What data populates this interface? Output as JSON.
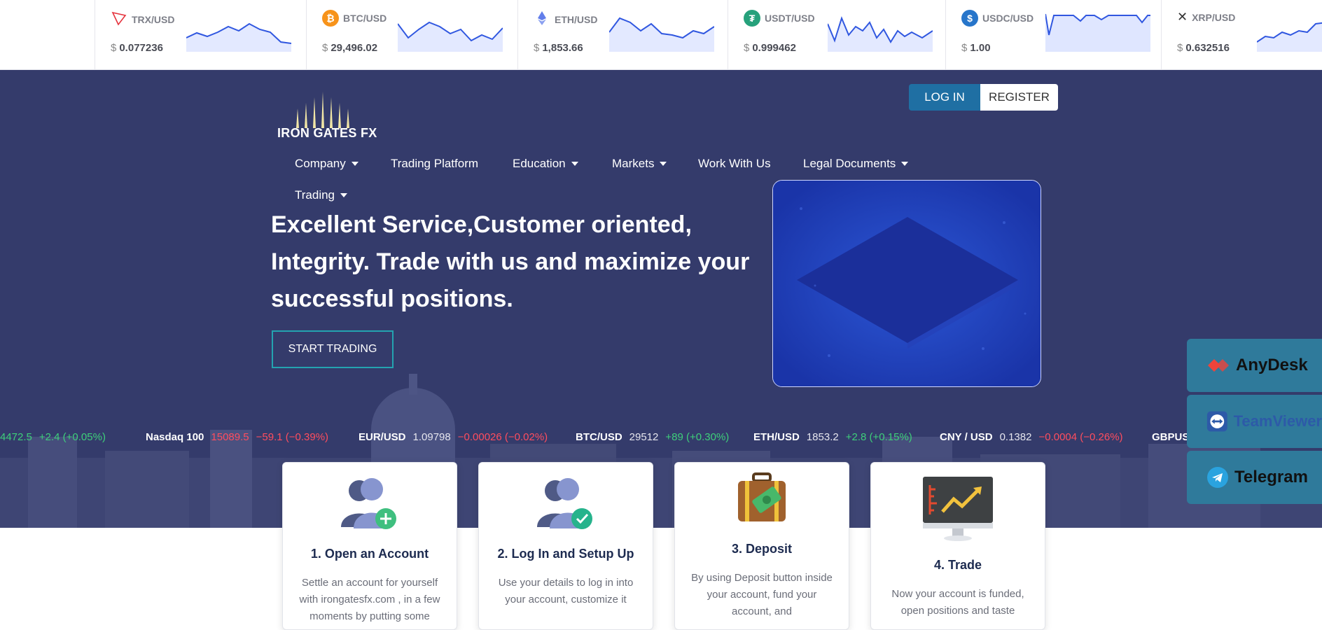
{
  "crypto_ticker": [
    {
      "pair": "TRX/USD",
      "currency": "$",
      "price": "0.077236",
      "icon": "tron-icon",
      "color": "#e5323c"
    },
    {
      "pair": "BTC/USD",
      "currency": "$",
      "price": "29,496.02",
      "icon": "bitcoin-icon",
      "color": "#f7931a"
    },
    {
      "pair": "ETH/USD",
      "currency": "$",
      "price": "1,853.66",
      "icon": "ethereum-icon",
      "color": "#627eea"
    },
    {
      "pair": "USDT/USD",
      "currency": "$",
      "price": "0.999462",
      "icon": "tether-icon",
      "color": "#26a17b"
    },
    {
      "pair": "USDC/USD",
      "currency": "$",
      "price": "1.00",
      "icon": "usdc-icon",
      "color": "#2775ca"
    },
    {
      "pair": "XRP/USD",
      "currency": "$",
      "price": "0.632516",
      "icon": "xrp-icon",
      "color": "#23292f"
    }
  ],
  "brand": {
    "name": "IRON GATES FX",
    "logo": "iron-gates-logo"
  },
  "auth": {
    "login": "LOG IN",
    "register": "REGISTER"
  },
  "nav": [
    {
      "label": "Company",
      "dropdown": true
    },
    {
      "label": "Trading Platform",
      "dropdown": false
    },
    {
      "label": "Education",
      "dropdown": true
    },
    {
      "label": "Markets",
      "dropdown": true
    },
    {
      "label": "Work With Us",
      "dropdown": false
    },
    {
      "label": "Legal Documents",
      "dropdown": true
    },
    {
      "label": "Trading",
      "dropdown": true
    }
  ],
  "hero": {
    "headline": "Excellent Service,Customer oriented, Integrity. Trade with us and maximize your successful positions.",
    "cta": "START TRADING"
  },
  "index_ticker": [
    {
      "name": "",
      "value": "4472.5",
      "change": "+2.4 (+0.05%)",
      "direction": "up"
    },
    {
      "name": "Nasdaq 100",
      "value": "15089.5",
      "change": "−59.1 (−0.39%)",
      "direction": "down"
    },
    {
      "name": "EUR/USD",
      "value": "1.09798",
      "change": "−0.00026 (−0.02%)",
      "direction": "down"
    },
    {
      "name": "BTC/USD",
      "value": "29512",
      "change": "+89 (+0.30%)",
      "direction": "up"
    },
    {
      "name": "ETH/USD",
      "value": "1853.2",
      "change": "+2.8 (+0.15%)",
      "direction": "up"
    },
    {
      "name": "CNY / USD",
      "value": "0.1382",
      "change": "−0.0004 (−0.26%)",
      "direction": "down"
    },
    {
      "name": "GBPUS",
      "value": "",
      "change": "",
      "direction": "up"
    }
  ],
  "side_widgets": [
    {
      "label": "AnyDesk",
      "icon": "anydesk-icon"
    },
    {
      "label": "TeamViewer",
      "icon": "teamviewer-icon"
    },
    {
      "label": "Telegram",
      "icon": "telegram-icon"
    }
  ],
  "steps": [
    {
      "title": "1. Open an Account",
      "text": "Settle an account for yourself with irongatesfx.com , in a few moments by putting some",
      "icon": "add-user-icon"
    },
    {
      "title": "2. Log In and Setup Up",
      "text": "Use your details to log in into your account, customize it",
      "icon": "verified-user-icon"
    },
    {
      "title": "3. Deposit",
      "text": "By using Deposit button inside your account, fund your account, and",
      "icon": "money-bag-icon"
    },
    {
      "title": "4. Trade",
      "text": "Now your account is funded, open positions and taste",
      "icon": "trading-monitor-icon"
    }
  ]
}
